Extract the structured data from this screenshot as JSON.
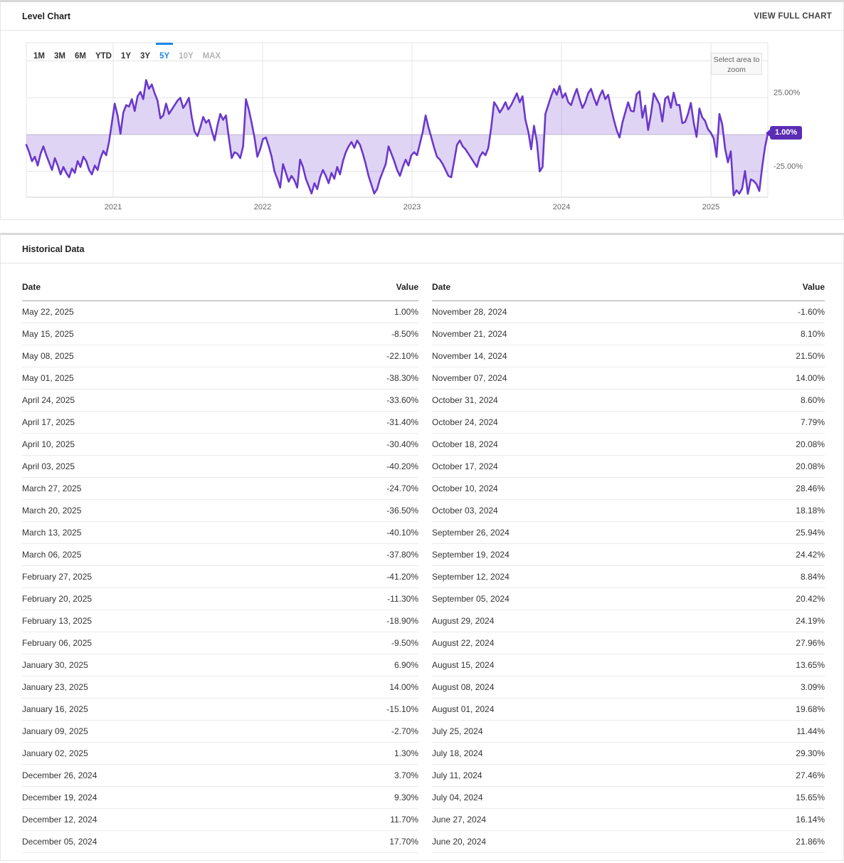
{
  "level_chart": {
    "title": "Level Chart",
    "action_label": "VIEW FULL CHART",
    "zoom_hint": "Select area to zoom",
    "badge": "1.00%",
    "ranges": [
      {
        "label": "1M",
        "state": "default"
      },
      {
        "label": "3M",
        "state": "default"
      },
      {
        "label": "6M",
        "state": "default"
      },
      {
        "label": "YTD",
        "state": "default"
      },
      {
        "label": "1Y",
        "state": "default"
      },
      {
        "label": "3Y",
        "state": "default"
      },
      {
        "label": "5Y",
        "state": "active"
      },
      {
        "label": "10Y",
        "state": "disabled"
      },
      {
        "label": "MAX",
        "state": "disabled"
      }
    ],
    "colors": {
      "line": "#6a38cc",
      "fill": "rgba(124,77,212,0.24)",
      "badge": "#5b2db3",
      "active_tab": "#1d86e8"
    }
  },
  "chart_data": {
    "type": "area",
    "title": "Level Chart",
    "frequency": "weekly",
    "x_start": "2020-06",
    "x_end": "2025-05-22",
    "baseline": 0,
    "ylim": [
      -45,
      62
    ],
    "end_value": 1.0,
    "end_value_label": "1.00%",
    "y_gridlines": [
      50,
      25,
      0,
      -25
    ],
    "y_axis_labels": [
      {
        "value": 25,
        "label": "25.00%"
      },
      {
        "value": -25,
        "label": "-25.00%"
      }
    ],
    "x_tick_labels": [
      "2021",
      "2022",
      "2023",
      "2024",
      "2025"
    ],
    "values": [
      -7,
      -12,
      -18,
      -15,
      -21,
      -13,
      -8,
      -14,
      -19,
      -24,
      -16,
      -21,
      -27,
      -22,
      -26,
      -29,
      -23,
      -26,
      -18,
      -22,
      -15,
      -18,
      -24,
      -27,
      -21,
      -24,
      -16,
      -11,
      -14,
      -5,
      8,
      21,
      13,
      0.5,
      15,
      20,
      19,
      24,
      16,
      26,
      29,
      24,
      37,
      31,
      34,
      28,
      23,
      11,
      13,
      21,
      14,
      17,
      20,
      23,
      25,
      18,
      21,
      25,
      12,
      2,
      -1,
      5,
      12,
      8,
      10,
      3,
      -4,
      6,
      14,
      10,
      13,
      -2,
      -16,
      -12,
      -13,
      -16,
      -8,
      24,
      17,
      8,
      -2,
      -15,
      -10,
      -3,
      -2,
      -8,
      -15,
      -25,
      -30,
      -36,
      -20,
      -26,
      -32,
      -28,
      -31,
      -36,
      -17,
      -22,
      -30,
      -35,
      -40,
      -33,
      -37,
      -29,
      -24,
      -28,
      -33,
      -26,
      -30,
      -22,
      -27,
      -18,
      -12,
      -8,
      -5,
      -9,
      -4,
      -7,
      -13,
      -20,
      -28,
      -34,
      -40,
      -37,
      -30,
      -25,
      -20,
      -8,
      -13,
      -18,
      -24,
      -28,
      -22,
      -17,
      -21,
      -14,
      -12,
      -14,
      -6,
      2,
      13,
      5,
      -2,
      -9,
      -15,
      -17,
      -20,
      -24,
      -28,
      -29,
      -18,
      -7,
      -4,
      -8,
      -10,
      -13,
      -16,
      -19,
      -22,
      -15,
      -12,
      -14,
      -9,
      5,
      22,
      19,
      15,
      18,
      22,
      17,
      20,
      24,
      28,
      22,
      26,
      10,
      2,
      -10,
      6,
      -5,
      -25,
      -22,
      14,
      20,
      26,
      31,
      27,
      33,
      25,
      28,
      22,
      20,
      26,
      31,
      24,
      18,
      22,
      28,
      31,
      25,
      20,
      26,
      30,
      24,
      27,
      18,
      10,
      3,
      -2,
      8,
      15,
      21.86,
      16.14,
      15.65,
      27.46,
      29.3,
      11.44,
      19.68,
      3.09,
      13.65,
      27.96,
      24.19,
      20.42,
      8.84,
      24.42,
      25.94,
      18.18,
      28.46,
      20.08,
      20.08,
      7.79,
      8.6,
      14,
      21.5,
      8.1,
      -1.6,
      17.7,
      11.7,
      9.3,
      3.7,
      1.3,
      -2.7,
      -15.1,
      14,
      6.9,
      -9.5,
      -18.9,
      -11.3,
      -41.2,
      -37.8,
      -40.1,
      -36.5,
      -24.7,
      -40.2,
      -30.4,
      -31.4,
      -33.6,
      -38.3,
      -22.1,
      -8.5,
      1
    ]
  },
  "historical": {
    "title": "Historical Data",
    "columns": {
      "date": "Date",
      "value": "Value"
    },
    "left_rows": [
      {
        "date": "May 22, 2025",
        "value": "1.00%"
      },
      {
        "date": "May 15, 2025",
        "value": "-8.50%"
      },
      {
        "date": "May 08, 2025",
        "value": "-22.10%"
      },
      {
        "date": "May 01, 2025",
        "value": "-38.30%"
      },
      {
        "date": "April 24, 2025",
        "value": "-33.60%"
      },
      {
        "date": "April 17, 2025",
        "value": "-31.40%"
      },
      {
        "date": "April 10, 2025",
        "value": "-30.40%"
      },
      {
        "date": "April 03, 2025",
        "value": "-40.20%"
      },
      {
        "date": "March 27, 2025",
        "value": "-24.70%"
      },
      {
        "date": "March 20, 2025",
        "value": "-36.50%"
      },
      {
        "date": "March 13, 2025",
        "value": "-40.10%"
      },
      {
        "date": "March 06, 2025",
        "value": "-37.80%"
      },
      {
        "date": "February 27, 2025",
        "value": "-41.20%"
      },
      {
        "date": "February 20, 2025",
        "value": "-11.30%"
      },
      {
        "date": "February 13, 2025",
        "value": "-18.90%"
      },
      {
        "date": "February 06, 2025",
        "value": "-9.50%"
      },
      {
        "date": "January 30, 2025",
        "value": "6.90%"
      },
      {
        "date": "January 23, 2025",
        "value": "14.00%"
      },
      {
        "date": "January 16, 2025",
        "value": "-15.10%"
      },
      {
        "date": "January 09, 2025",
        "value": "-2.70%"
      },
      {
        "date": "January 02, 2025",
        "value": "1.30%"
      },
      {
        "date": "December 26, 2024",
        "value": "3.70%"
      },
      {
        "date": "December 19, 2024",
        "value": "9.30%"
      },
      {
        "date": "December 12, 2024",
        "value": "11.70%"
      },
      {
        "date": "December 05, 2024",
        "value": "17.70%"
      }
    ],
    "right_rows": [
      {
        "date": "November 28, 2024",
        "value": "-1.60%"
      },
      {
        "date": "November 21, 2024",
        "value": "8.10%"
      },
      {
        "date": "November 14, 2024",
        "value": "21.50%"
      },
      {
        "date": "November 07, 2024",
        "value": "14.00%"
      },
      {
        "date": "October 31, 2024",
        "value": "8.60%"
      },
      {
        "date": "October 24, 2024",
        "value": "7.79%"
      },
      {
        "date": "October 18, 2024",
        "value": "20.08%"
      },
      {
        "date": "October 17, 2024",
        "value": "20.08%"
      },
      {
        "date": "October 10, 2024",
        "value": "28.46%"
      },
      {
        "date": "October 03, 2024",
        "value": "18.18%"
      },
      {
        "date": "September 26, 2024",
        "value": "25.94%"
      },
      {
        "date": "September 19, 2024",
        "value": "24.42%"
      },
      {
        "date": "September 12, 2024",
        "value": "8.84%"
      },
      {
        "date": "September 05, 2024",
        "value": "20.42%"
      },
      {
        "date": "August 29, 2024",
        "value": "24.19%"
      },
      {
        "date": "August 22, 2024",
        "value": "27.96%"
      },
      {
        "date": "August 15, 2024",
        "value": "13.65%"
      },
      {
        "date": "August 08, 2024",
        "value": "3.09%"
      },
      {
        "date": "August 01, 2024",
        "value": "19.68%"
      },
      {
        "date": "July 25, 2024",
        "value": "11.44%"
      },
      {
        "date": "July 18, 2024",
        "value": "29.30%"
      },
      {
        "date": "July 11, 2024",
        "value": "27.46%"
      },
      {
        "date": "July 04, 2024",
        "value": "15.65%"
      },
      {
        "date": "June 27, 2024",
        "value": "16.14%"
      },
      {
        "date": "June 20, 2024",
        "value": "21.86%"
      }
    ]
  }
}
